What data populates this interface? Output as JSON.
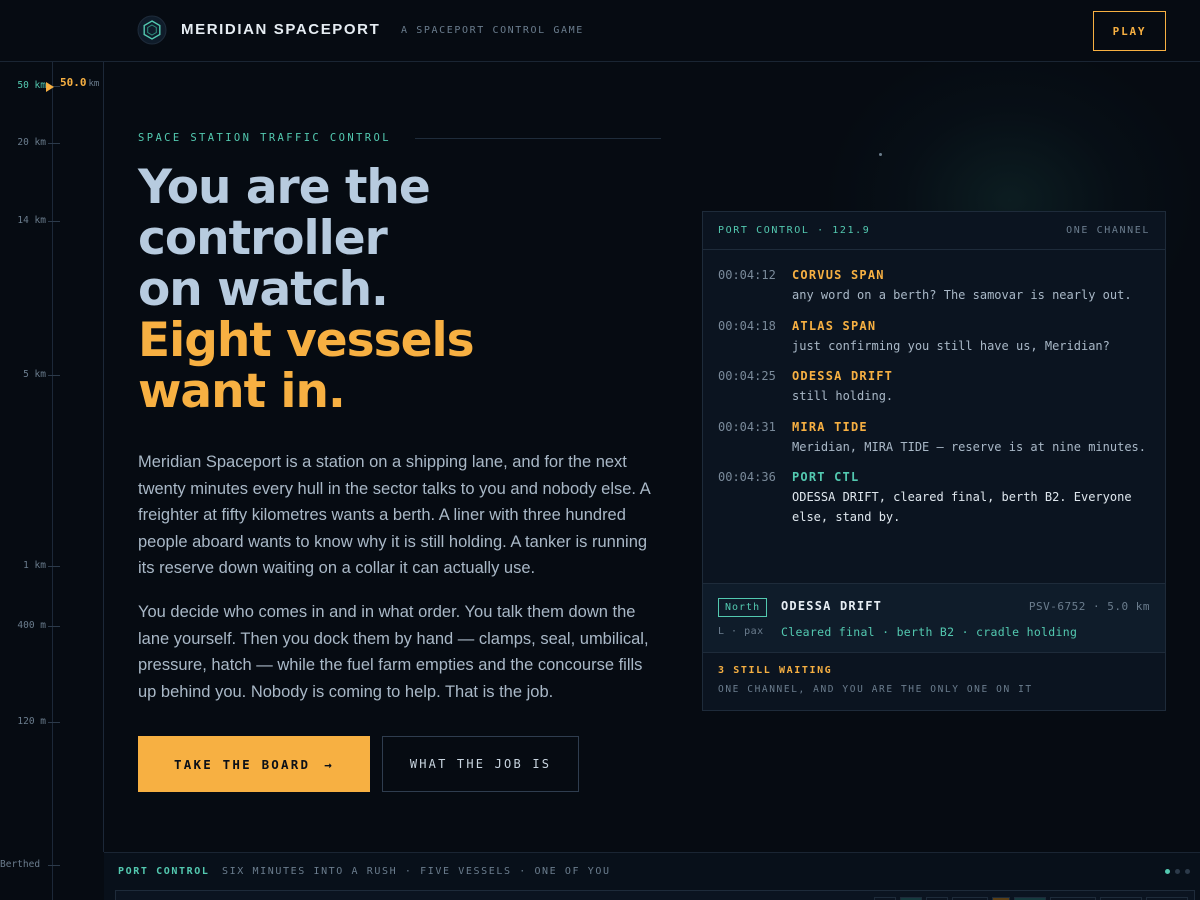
{
  "header": {
    "brand": "MERIDIAN SPACEPORT",
    "tagline": "A SPACEPORT CONTROL GAME",
    "play_label": "PLAY",
    "logo_icon": "hexagon-station-icon"
  },
  "altimeter": {
    "ticks": [
      "50 km",
      "20 km",
      "14 km",
      "5 km",
      "1 km",
      "400 m",
      "120 m",
      "Berthed"
    ],
    "current_value": "50.0",
    "current_unit": "km"
  },
  "hero": {
    "eyebrow": "SPACE STATION TRAFFIC CONTROL",
    "headline_line1": "You are the",
    "headline_line2": "controller",
    "headline_line3": "on watch.",
    "headline_accent1": "Eight vessels",
    "headline_accent2": "want in.",
    "paragraph1": "Meridian Spaceport is a station on a shipping lane, and for the next twenty minutes every hull in the sector talks to you and nobody else. A freighter at fifty kilometres wants a berth. A liner with three hundred people aboard wants to know why it is still holding. A tanker is running its reserve down waiting on a collar it can actually use.",
    "paragraph2": "You decide who comes in and in what order. You talk them down the lane yourself. Then you dock them by hand — clamps, seal, umbilical, pressure, hatch — while the fuel farm empties and the concourse fills up behind you. Nobody is coming to help. That is the job.",
    "primary_cta": "TAKE THE BOARD",
    "primary_cta_arrow": "→",
    "secondary_cta": "WHAT THE JOB IS"
  },
  "radio": {
    "frequency": "PORT CONTROL · 121.9",
    "channel": "ONE CHANNEL",
    "messages": [
      {
        "time": "00:04:12",
        "from": "CORVUS SPAN",
        "text": "any word on a berth? The samovar is nearly out."
      },
      {
        "time": "00:04:18",
        "from": "ATLAS SPAN",
        "text": "just confirming you still have us, Meridian?"
      },
      {
        "time": "00:04:25",
        "from": "ODESSA DRIFT",
        "text": "still holding."
      },
      {
        "time": "00:04:31",
        "from": "MIRA TIDE",
        "text": "Meridian, MIRA TIDE — reserve is at nine minutes."
      },
      {
        "time": "00:04:36",
        "from": "PORT CTL",
        "text": "ODESSA DRIFT, cleared final, berth B2. Everyone else, stand by."
      }
    ],
    "strip": {
      "approach": "North",
      "vessel": "ODESSA DRIFT",
      "registry": "PSV-6752 · 5.0 km",
      "class": "L · pax",
      "status": "Cleared final · berth B2 · cradle holding"
    },
    "waiting_count": "3 STILL WAITING",
    "waiting_note": "ONE CHANNEL, AND YOU ARE THE ONLY ONE ON IT"
  },
  "footer": {
    "label": "PORT CONTROL",
    "description": "SIX MINUTES INTO A RUSH · FIVE VESSELS · ONE OF YOU"
  },
  "colors": {
    "background": "#060b12",
    "accent_amber": "#f7b042",
    "accent_teal": "#53c9b0",
    "headline": "#b7cbdf"
  }
}
